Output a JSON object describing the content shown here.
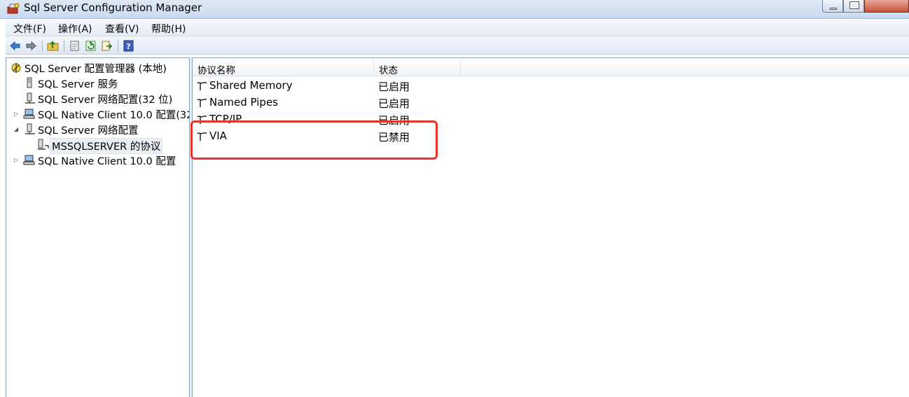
{
  "window": {
    "title": "Sql Server Configuration Manager",
    "icon": "sql-config-manager-icon"
  },
  "menu": [
    {
      "label": "文件(F)"
    },
    {
      "label": "操作(A)"
    },
    {
      "label": "查看(V)"
    },
    {
      "label": "帮助(H)"
    }
  ],
  "toolbar": {
    "icons": [
      "back-arrow-icon",
      "forward-arrow-icon",
      "up-folder-icon",
      "properties-icon",
      "refresh-icon",
      "export-icon",
      "help-icon"
    ]
  },
  "tree": {
    "root": "SQL Server 配置管理器 (本地)",
    "items": [
      {
        "label": "SQL Server 服务"
      },
      {
        "label": "SQL Server 网络配置(32 位)"
      },
      {
        "label": "SQL Native Client 10.0 配置(32"
      },
      {
        "label": "SQL Server 网络配置"
      },
      {
        "label": "MSSQLSERVER 的协议"
      },
      {
        "label": "SQL Native Client 10.0 配置"
      }
    ]
  },
  "list": {
    "columns": [
      "协议名称",
      "状态"
    ],
    "rows": [
      {
        "name": "Shared Memory",
        "status": "已启用"
      },
      {
        "name": "Named Pipes",
        "status": "已启用"
      },
      {
        "name": "TCP/IP",
        "status": "已启用"
      },
      {
        "name": "VIA",
        "status": "已禁用"
      }
    ]
  },
  "colors": {
    "highlight": "#e8352b",
    "title_bar": "#dfe9f5",
    "close_button": "#c8513b"
  }
}
